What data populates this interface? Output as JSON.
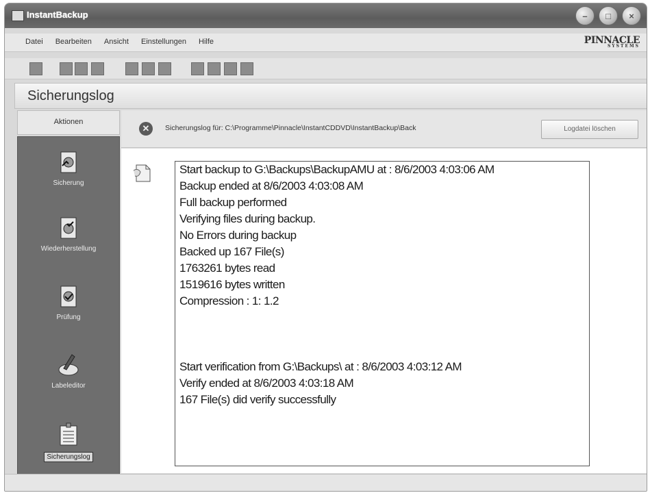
{
  "window": {
    "title": "InstantBackup",
    "buttons": [
      {
        "name": "minimize-button",
        "glyph": "–"
      },
      {
        "name": "maximize-button",
        "glyph": "□"
      },
      {
        "name": "close-button",
        "glyph": "×"
      }
    ]
  },
  "menu": [
    "Datei",
    "Bearbeiten",
    "Ansicht",
    "Einstellungen",
    "Hilfe"
  ],
  "brand": {
    "name": "PINNACLE",
    "sub": "SYSTEMS"
  },
  "toolbar": {
    "icons": [
      "tool-icon",
      "tool-icon",
      "tool-icon",
      "tool-icon",
      "tool-icon",
      "tool-icon",
      "tool-icon",
      "tool-icon",
      "tool-icon",
      "tool-icon",
      "tool-icon"
    ]
  },
  "section": {
    "title": "Sicherungslog"
  },
  "sidebar": {
    "tab": "Aktionen",
    "actions": [
      {
        "label": "Sicherung",
        "icon": "backup-icon"
      },
      {
        "label": "Wiederherstellung",
        "icon": "restore-icon"
      },
      {
        "label": "Prüfung",
        "icon": "verify-icon"
      },
      {
        "label": "Labeleditor",
        "icon": "label-editor-icon"
      },
      {
        "label": "Sicherungslog",
        "icon": "backup-log-icon",
        "selected": true
      }
    ]
  },
  "logheader": {
    "path": "Sicherungslog für: C:\\Programme\\Pinnacle\\InstantCDDVD\\InstantBackup\\Back",
    "delete_button": "Logdatei löschen"
  },
  "log": {
    "lines": [
      "Start backup to G:\\Backups\\BackupAMU at : 8/6/2003 4:03:06 AM",
      "Backup ended at 8/6/2003 4:03:08 AM",
      "Full backup performed",
      "Verifying files during backup.",
      "No Errors during backup",
      "Backed up 167 File(s)",
      "1763261 bytes read",
      "1519616 bytes written",
      "Compression : 1: 1.2",
      "",
      "",
      "",
      "Start verification from G:\\Backups\\ at : 8/6/2003 4:03:12 AM",
      "Verify ended at 8/6/2003 4:03:18 AM",
      "167 File(s) did verify successfully"
    ]
  }
}
